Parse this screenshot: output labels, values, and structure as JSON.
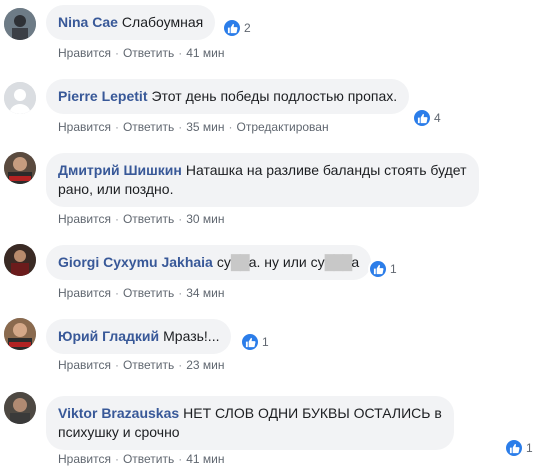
{
  "actions": {
    "like": "Нравится",
    "reply": "Ответить",
    "sep": "·"
  },
  "accent": "#385898",
  "comments": [
    {
      "author": "Nina Cae",
      "text": "Слабоумная",
      "reactions": "2",
      "time": "41 мин",
      "edited": ""
    },
    {
      "author": "Pierre Lepetit",
      "text": "Этот день победы подлостью пропах.",
      "reactions": "4",
      "time": "35 мин",
      "edited": "Отредактирован"
    },
    {
      "author": "Дмитрий Шишкин",
      "text_line1": "Наташка на разливе баланды стоять будет",
      "text_line2": "рано, или поздно.",
      "time": "30 мин"
    },
    {
      "author": "Giorgi Cyxymu Jakhaia",
      "text_a": "су",
      "redacted_a": "██",
      "text_b": "а. ну или су",
      "redacted_b": "███",
      "text_c": "а",
      "reactions": "1",
      "time": "34 мин"
    },
    {
      "author": "Юрий Гладкий",
      "text": "Мразь!...",
      "reactions": "1",
      "time": "23 мин"
    },
    {
      "author": "Viktor Brazauskas",
      "text_line1": "НЕТ СЛОВ ОДНИ БУКВЫ ОСТАЛИСЬ в",
      "text_line2": "психушку и срочно",
      "reactions": "1",
      "time": "41 мин"
    }
  ]
}
